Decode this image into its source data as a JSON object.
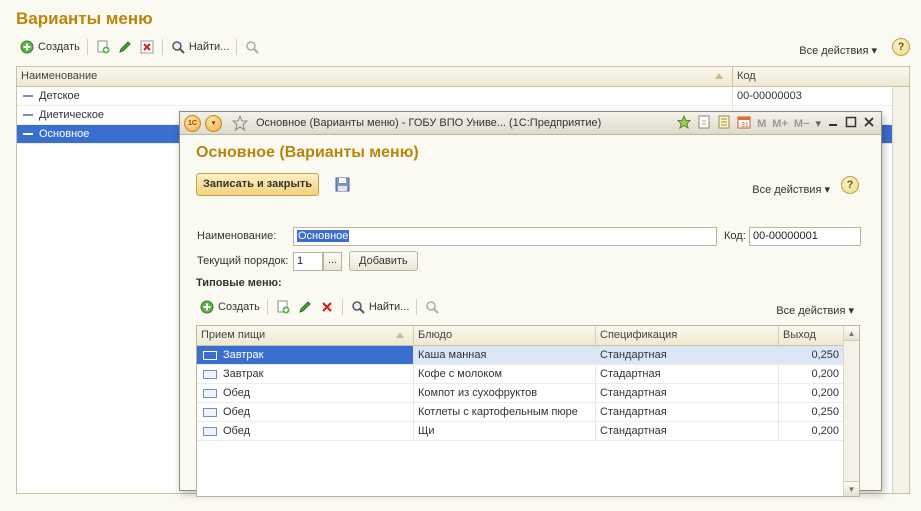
{
  "list_form": {
    "title": "Варианты меню",
    "toolbar": {
      "create_label": "Создать",
      "find_label": "Найти...",
      "all_actions_label": "Все действия ▾",
      "help_label": "?"
    },
    "columns": {
      "name": "Наименование",
      "code": "Код"
    },
    "rows": [
      {
        "name": "Детское",
        "code": "00-00000003"
      },
      {
        "name": "Диетическое",
        "code": ""
      },
      {
        "name": "Основное",
        "code": ""
      }
    ]
  },
  "window": {
    "title": "Основное (Варианты меню) - ГОБУ ВПО Униве...   (1С:Предприятие)",
    "app_icon_text": "1С",
    "tools": {
      "m": "M",
      "m_plus": "M+",
      "m_minus": "M−"
    }
  },
  "form": {
    "title": "Основное (Варианты меню)",
    "save_close_label": "Записать и закрыть",
    "all_actions_label": "Все действия ▾",
    "help_label": "?",
    "name_label": "Наименование:",
    "name_value": "Основное",
    "code_label": "Код:",
    "code_value": "00-00000001",
    "order_label": "Текущий порядок:",
    "order_value": "1",
    "dots_label": "...",
    "add_label": "Добавить",
    "section_label": "Типовые меню:",
    "inner_toolbar": {
      "create_label": "Создать",
      "find_label": "Найти...",
      "all_actions_label": "Все действия ▾"
    },
    "grid_columns": {
      "meal": "Прием пищи",
      "dish": "Блюдо",
      "spec": "Спецификация",
      "output": "Выход"
    },
    "grid_rows": [
      {
        "meal": "Завтрак",
        "dish": "Каша манная",
        "spec": "Стандартная",
        "output": "0,250"
      },
      {
        "meal": "Завтрак",
        "dish": "Кофе с молоком",
        "spec": "Стадартная",
        "output": "0,200"
      },
      {
        "meal": "Обед",
        "dish": "Компот из сухофруктов",
        "spec": "Стандартная",
        "output": "0,200"
      },
      {
        "meal": "Обед",
        "dish": "Котлеты с картофельным пюре",
        "spec": "Стандартная",
        "output": "0,250"
      },
      {
        "meal": "Обед",
        "dish": "Щи",
        "spec": "Стандартная",
        "output": "0,200"
      }
    ]
  },
  "colors": {
    "accent_title": "#b8860b",
    "selection": "#3a6fd0",
    "button_yellow": "#f3d179"
  }
}
